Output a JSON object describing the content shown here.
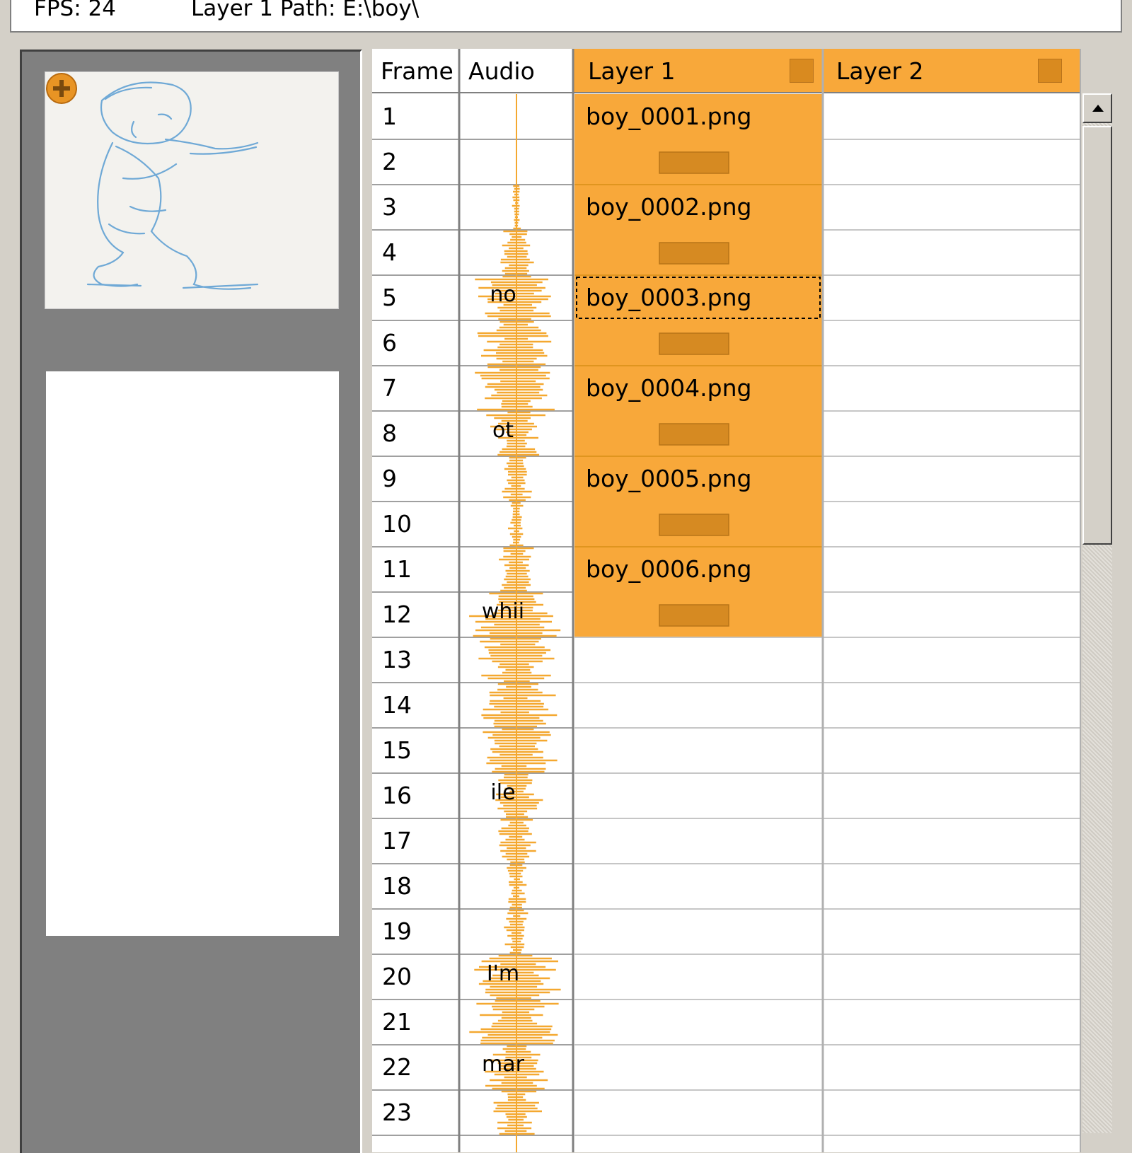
{
  "info": {
    "fps": "FPS: 24",
    "path": "Layer 1 Path: E:\\boy\\"
  },
  "preview": {
    "add_icon": "plus-circle-icon"
  },
  "sheet": {
    "columns": {
      "frame": "Frame",
      "audio": "Audio",
      "layer1": "Layer 1",
      "layer2": "Layer 2"
    },
    "frames": [
      "1",
      "2",
      "3",
      "4",
      "5",
      "6",
      "7",
      "8",
      "9",
      "10",
      "11",
      "12",
      "13",
      "14",
      "15",
      "16",
      "17",
      "18",
      "19",
      "20",
      "21",
      "22",
      "23"
    ],
    "layer1_cells": [
      {
        "frame": 1,
        "file": "boy_0001.png"
      },
      {
        "frame": 3,
        "file": "boy_0002.png"
      },
      {
        "frame": 5,
        "file": "boy_0003.png",
        "selected": true
      },
      {
        "frame": 7,
        "file": "boy_0004.png"
      },
      {
        "frame": 9,
        "file": "boy_0005.png"
      },
      {
        "frame": 11,
        "file": "boy_0006.png"
      }
    ],
    "lyrics": [
      {
        "frame": 5,
        "text": "no"
      },
      {
        "frame": 8,
        "text": "ot"
      },
      {
        "frame": 12,
        "text": "whii"
      },
      {
        "frame": 16,
        "text": "ile"
      },
      {
        "frame": 20,
        "text": "I'm"
      },
      {
        "frame": 22,
        "text": "mar"
      }
    ],
    "colors": {
      "orange": "#f8a83a",
      "orange_dark": "#d98a1f",
      "hold_bar": "#d68a22",
      "wave": "#f4a830"
    }
  }
}
